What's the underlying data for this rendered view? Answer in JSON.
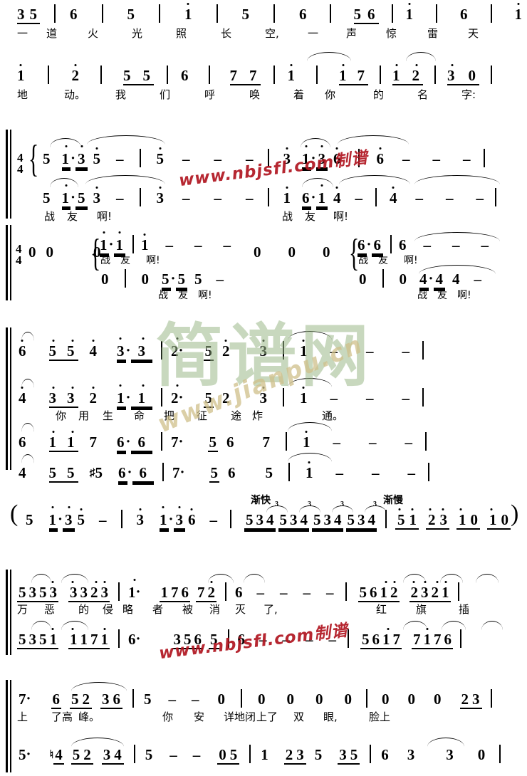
{
  "document": {
    "type": "jianpu-numbered-musical-notation",
    "language": "zh-CN"
  },
  "watermarks": {
    "red_top": "www.nbjsfl.com制谱",
    "red_bottom": "www.nbjsfl.com制谱",
    "green_logo": "简谱网",
    "green_url": "www.jianpu.cn"
  },
  "tempo_marks": {
    "accel": "渐快",
    "rit": "渐慢"
  },
  "time_signatures": {
    "upper_system": "4/4",
    "lower_system": "4/4",
    "numerator": "4",
    "denominator": "4"
  },
  "systems": [
    {
      "id": "system-1",
      "voices": [
        {
          "id": "melody-1a",
          "notes": "3 5 | 6 | 5 | 1' | 5 | 6 | 5 6 | 1' | 6 | 1' |"
        }
      ],
      "lyrics": [
        "一",
        "道",
        "火",
        "光",
        "照",
        "长",
        "空,",
        "一",
        "声",
        "惊",
        "雷",
        "天"
      ]
    },
    {
      "id": "system-2",
      "voices": [
        {
          "id": "melody-1b",
          "notes": "1' | 2' | 5 5 | 6 | 7 7 | 1' | 1' 7 | 1' 2' | 3' 0 |"
        }
      ],
      "lyrics": [
        "地",
        "动。",
        "我",
        "们",
        "呼",
        "唤",
        "着",
        "你",
        "的",
        "名",
        "字:"
      ]
    },
    {
      "id": "system-3",
      "label": "SATB chorus — 4/4",
      "voices": [
        {
          "id": "soprano",
          "notes": "5 1'· 3' 5' - | 5' - - - | 3' 1'· 3' 6' | 6' - - - |"
        },
        {
          "id": "alto",
          "notes": "5 1'· 5 3' - | 3' - - - | 1' 6· 1' 4' - | 4' - - - |"
        },
        {
          "id": "tenor",
          "notes": "0 0 0 { 1'· 1' | 1' - - - } 0 0 0 { 6· 6 | 6 - - - |"
        },
        {
          "id": "bass",
          "notes": "0 | 0 5· 5 5 - | 0 | 0 4· 4 4 - |"
        }
      ],
      "lyrics_alto": [
        "战",
        "友",
        "啊!",
        "战",
        "友",
        "啊!"
      ],
      "lyrics_tenor": [
        "战",
        "友",
        "啊!",
        "战",
        "友",
        "啊!"
      ],
      "lyrics_bass": [
        "战",
        "友",
        "啊!",
        "战",
        "友",
        "啊!"
      ]
    },
    {
      "id": "system-4",
      "label": "SATB chorus",
      "voices": [
        {
          "id": "soprano",
          "notes": "6' 5' 5' 4' 3'· 3' | 2'· 5 2' 3' | 1' - - - |"
        },
        {
          "id": "alto",
          "notes": "4' 3' 3' 2' 1'· 1' | 2'· 5 2 3' | 1' - - - |"
        },
        {
          "id": "tenor",
          "notes": "6 1' 1' 7 6· 6 | 7· 5 6 7 | 1' - - - |"
        },
        {
          "id": "bass",
          "notes": "4 5 5 #5 6· 6 | 7· 5 6 5 | 1' - - - |"
        }
      ],
      "lyrics": [
        "你",
        "用",
        "生",
        "命",
        "把",
        "征",
        "途",
        "炸",
        "通。"
      ]
    },
    {
      "id": "system-5",
      "label": "instrumental interlude (in parentheses)",
      "voices": [
        {
          "id": "interlude",
          "notes": "( 5 1'· 3' 5' - | 3' 1'· 3' 6' - | 5 3 4 5 3 4 5 3 4 5 3 4 | 5' 1' 2' 3' 1' 0 1' 0 )"
        }
      ],
      "triplet_numerals": [
        "3",
        "3",
        "3",
        "3"
      ]
    },
    {
      "id": "system-6",
      "label": "two-voice chorus",
      "voices": [
        {
          "id": "upper",
          "notes": "5 3 5 3 3 3 2 3 | 1'· 1' 7 6 7 2' | 6 - - - | 5 6 1' 2' 2' 3' 2' 1' |"
        },
        {
          "id": "lower",
          "notes": "5 3 5 1' 1' 1' 7 1' | 6· 3 5 6 5 | 6 - - - | 5 6 1' 7 7 1' 7 6 |"
        }
      ],
      "lyrics": [
        "万",
        "恶",
        "的",
        "侵",
        "略",
        "者",
        "被",
        "消",
        "灭",
        "了,",
        "红",
        "旗",
        "插"
      ]
    },
    {
      "id": "system-7",
      "label": "two-voice chorus",
      "voices": [
        {
          "id": "upper",
          "notes": "7· 6 5 2 3 6 | 5 - - 0 | 0 0 0 0 | 0 0 0 2 3 |"
        },
        {
          "id": "lower",
          "notes": "5· b4 5 2 3 4 | 5 - - 0 5 | 1 2 3 5 3 5 | 6 3 3 0 |"
        }
      ],
      "lyrics": [
        "上",
        "了高",
        "峰。",
        "你",
        "安",
        "详地闭",
        "上了",
        "双",
        "眼,",
        "脸上"
      ]
    }
  ]
}
